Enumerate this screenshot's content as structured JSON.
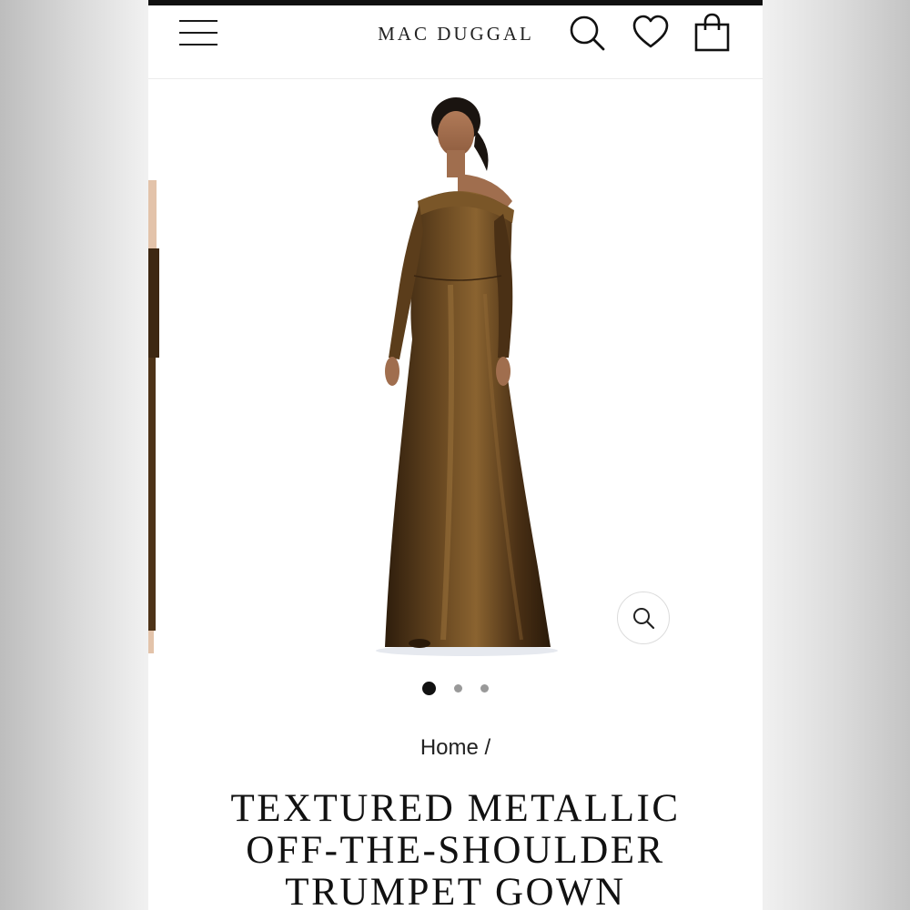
{
  "brand": {
    "logo_text": "MAC DUGGAL"
  },
  "header": {
    "icons": [
      "menu-icon",
      "search-icon",
      "heart-icon",
      "shopping-bag-icon"
    ]
  },
  "gallery": {
    "current_slide": 1,
    "slide_count": 3,
    "zoom_icon": "zoom-search-icon",
    "product_image_color": "#4a3015"
  },
  "breadcrumb": {
    "home_label": "Home",
    "separator": "/"
  },
  "product": {
    "title_line_1": "TEXTURED METALLIC",
    "title_line_2": "OFF-THE-SHOULDER",
    "title_line_3": "TRUMPET GOWN"
  },
  "colors": {
    "top_bar": "#111111",
    "text": "#111111",
    "dot_inactive": "#999999"
  }
}
